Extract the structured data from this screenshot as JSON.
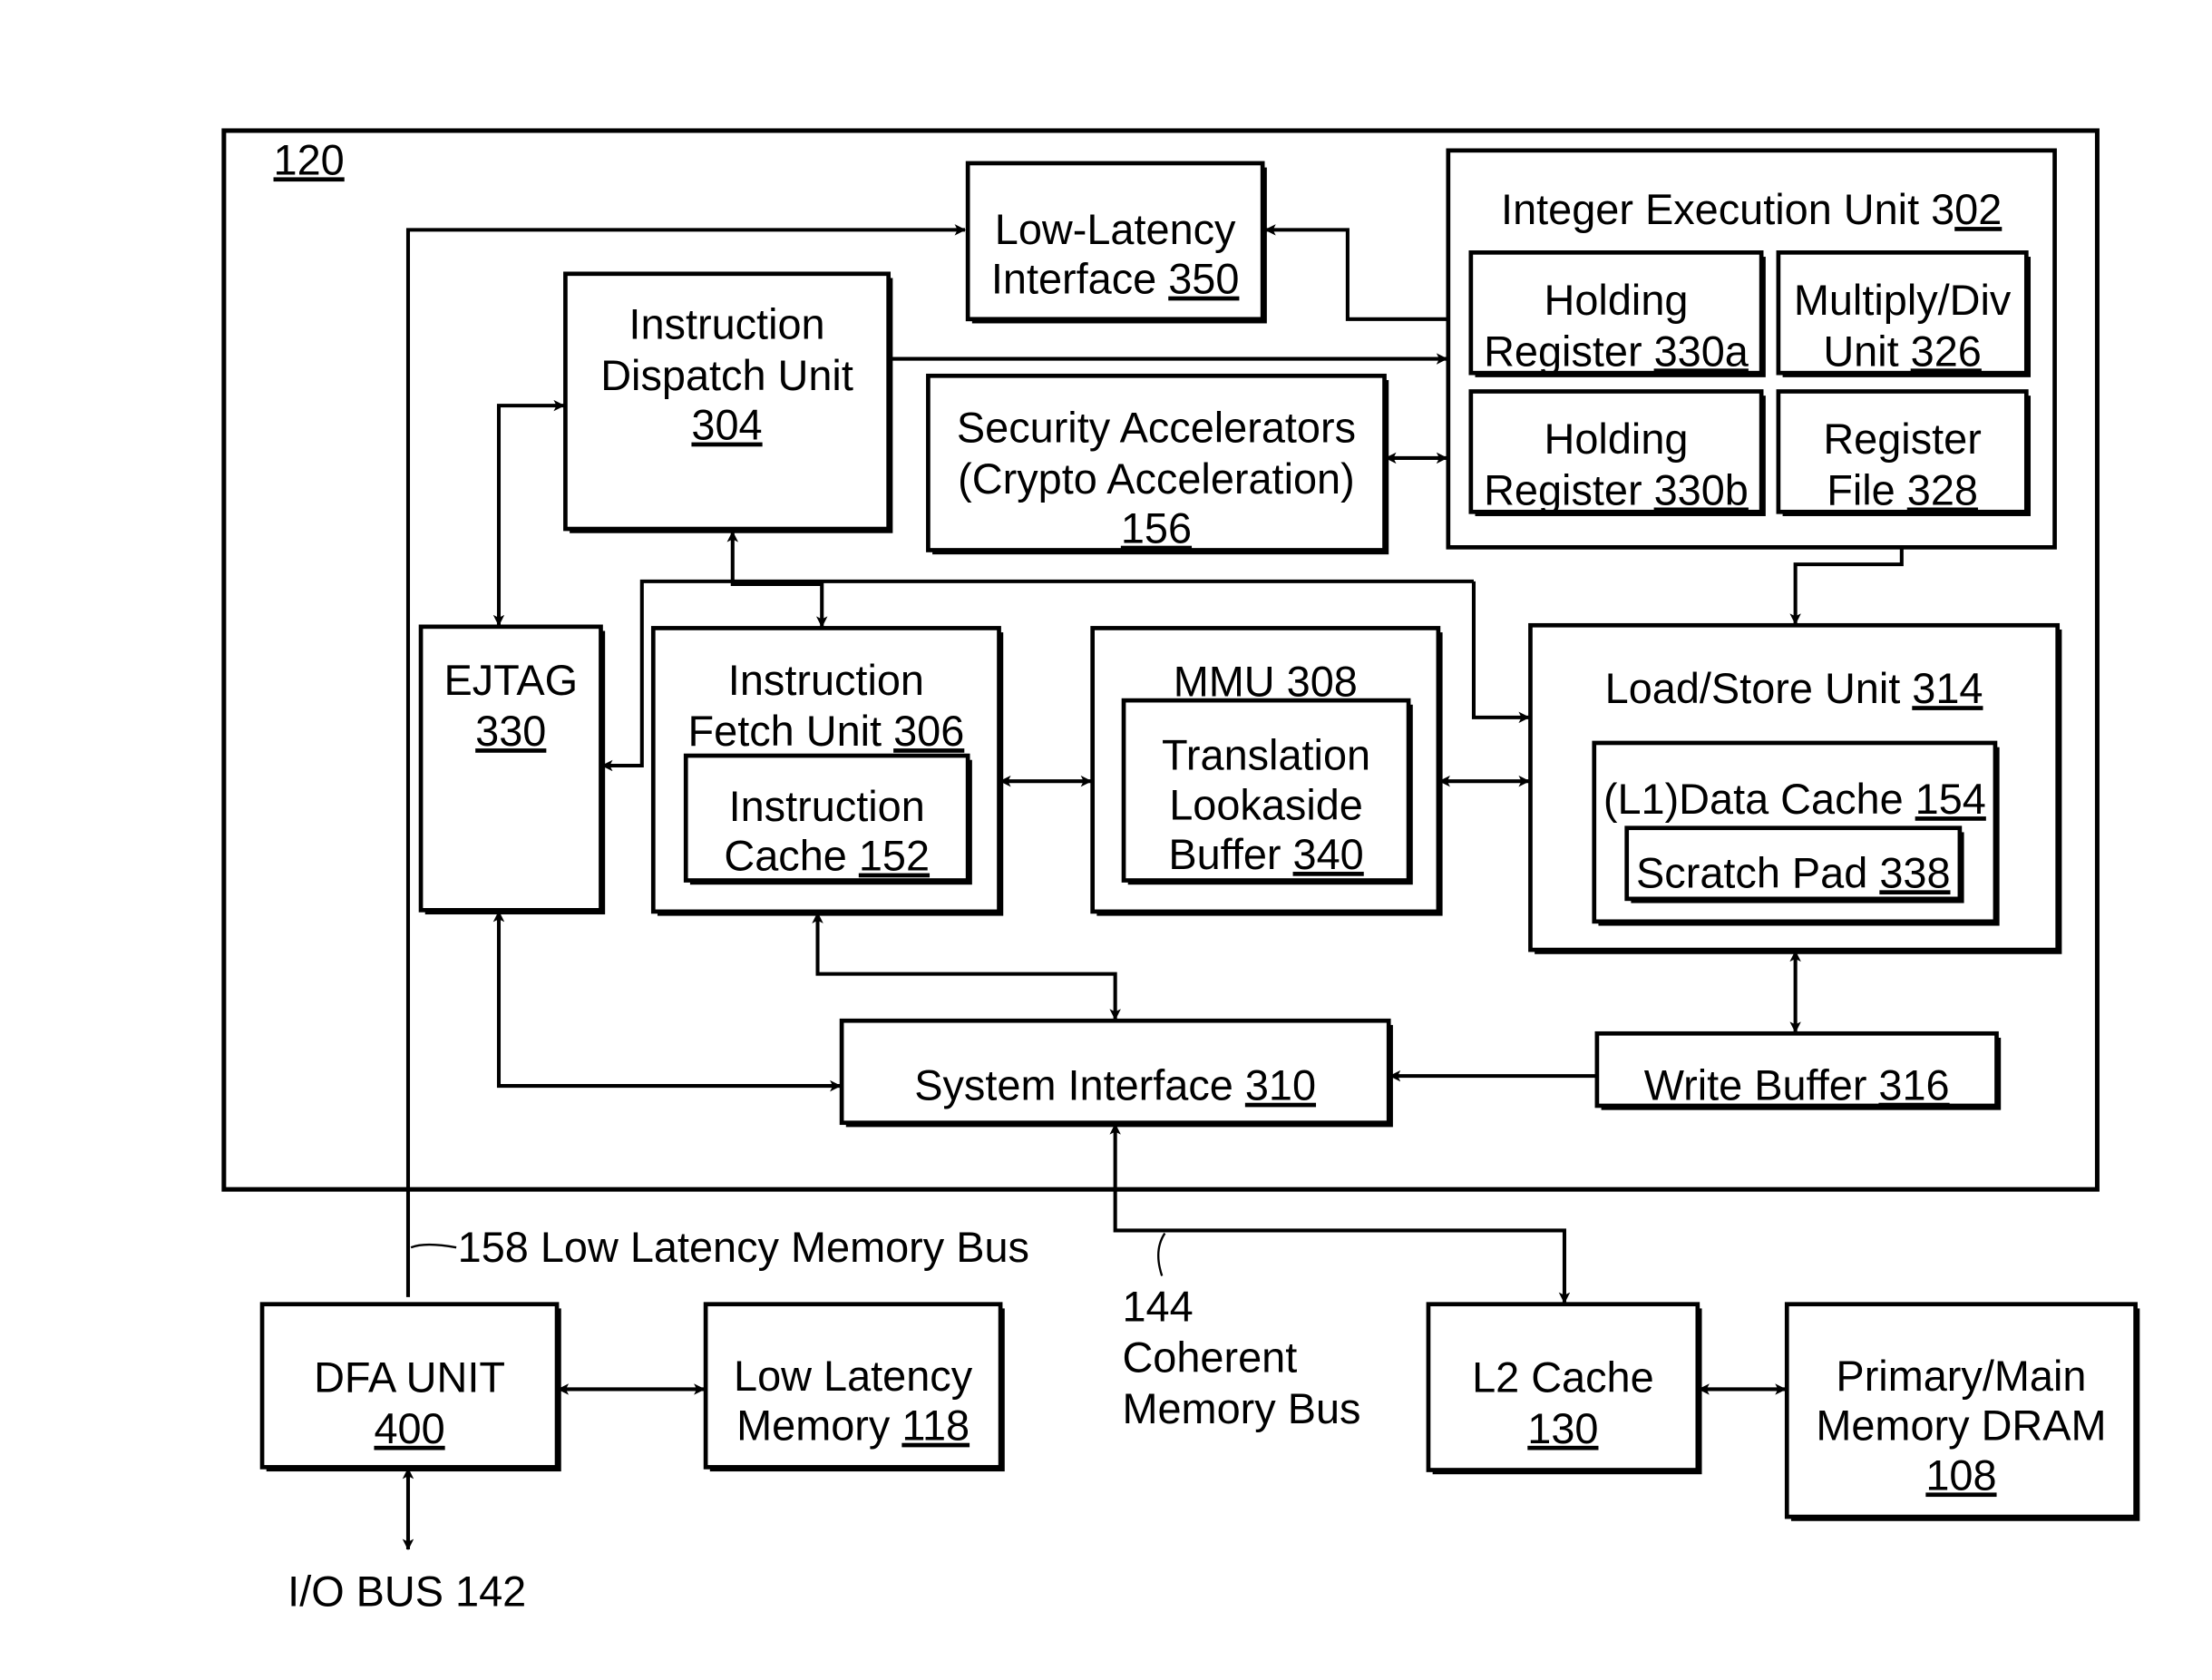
{
  "figure": {
    "outer_label": "120",
    "blocks": [
      {
        "id": "low-latency-interface",
        "lines": [
          [
            "Low-Latency",
            ""
          ],
          [
            "Interface ",
            "350"
          ]
        ]
      },
      {
        "id": "integer-execution-unit",
        "lines": [
          [
            "Integer Execution Unit 3",
            "02"
          ]
        ]
      },
      {
        "id": "holding-register-a",
        "lines": [
          [
            "Holding",
            ""
          ],
          [
            "Register ",
            "330a"
          ]
        ]
      },
      {
        "id": "multiply-div-unit",
        "lines": [
          [
            "Multiply/Div",
            ""
          ],
          [
            "Unit ",
            "326"
          ]
        ]
      },
      {
        "id": "holding-register-b",
        "lines": [
          [
            "Holding",
            ""
          ],
          [
            "Register ",
            "330b"
          ]
        ]
      },
      {
        "id": "register-file",
        "lines": [
          [
            "Register",
            ""
          ],
          [
            "File ",
            "328"
          ]
        ]
      },
      {
        "id": "instruction-dispatch-unit",
        "lines": [
          [
            "Instruction",
            ""
          ],
          [
            "Dispatch Unit",
            ""
          ],
          [
            "",
            "304"
          ]
        ]
      },
      {
        "id": "security-accelerators",
        "lines": [
          [
            "Security Accelerators",
            ""
          ],
          [
            "(Crypto Acceleration)",
            ""
          ],
          [
            "",
            "156"
          ]
        ]
      },
      {
        "id": "ejtag",
        "lines": [
          [
            "EJTAG",
            ""
          ],
          [
            "",
            "330"
          ]
        ]
      },
      {
        "id": "instruction-fetch-unit",
        "lines": [
          [
            "Instruction",
            ""
          ],
          [
            "Fetch Unit ",
            "306"
          ]
        ]
      },
      {
        "id": "instruction-cache",
        "lines": [
          [
            "Instruction",
            ""
          ],
          [
            "Cache ",
            "152"
          ]
        ]
      },
      {
        "id": "mmu",
        "lines": [
          [
            "MMU ",
            "308"
          ]
        ]
      },
      {
        "id": "translation-lookaside-buffer",
        "lines": [
          [
            "Translation",
            ""
          ],
          [
            "Lookaside",
            ""
          ],
          [
            "Buffer ",
            "340"
          ]
        ]
      },
      {
        "id": "load-store-unit",
        "lines": [
          [
            "Load/Store Unit ",
            "314"
          ]
        ]
      },
      {
        "id": "l1-data-cache",
        "lines": [
          [
            "(L1)Data Cache ",
            "154"
          ]
        ]
      },
      {
        "id": "scratch-pad",
        "lines": [
          [
            "Scratch Pad ",
            "338"
          ]
        ]
      },
      {
        "id": "system-interface",
        "lines": [
          [
            "System Interface ",
            "310"
          ]
        ]
      },
      {
        "id": "write-buffer",
        "lines": [
          [
            "Write Buffer ",
            "316"
          ]
        ]
      },
      {
        "id": "dfa-unit",
        "lines": [
          [
            "DFA UNIT",
            ""
          ],
          [
            "",
            "400"
          ]
        ]
      },
      {
        "id": "low-latency-memory",
        "lines": [
          [
            "Low Latency",
            ""
          ],
          [
            "Memory ",
            "118"
          ]
        ]
      },
      {
        "id": "l2-cache",
        "lines": [
          [
            "L2 Cache",
            ""
          ],
          [
            "",
            "130"
          ]
        ]
      },
      {
        "id": "main-memory-dram",
        "lines": [
          [
            "Primary/Main",
            ""
          ],
          [
            "Memory DRAM",
            ""
          ],
          [
            "",
            "108"
          ]
        ]
      }
    ],
    "annotations": [
      {
        "id": "low-latency-memory-bus-label",
        "lines": [
          "158 Low Latency Memory Bus"
        ]
      },
      {
        "id": "coherent-memory-bus-label",
        "lines": [
          "144",
          "Coherent",
          "Memory Bus"
        ]
      },
      {
        "id": "io-bus-label",
        "lines": [
          "I/O BUS 142"
        ]
      }
    ]
  }
}
